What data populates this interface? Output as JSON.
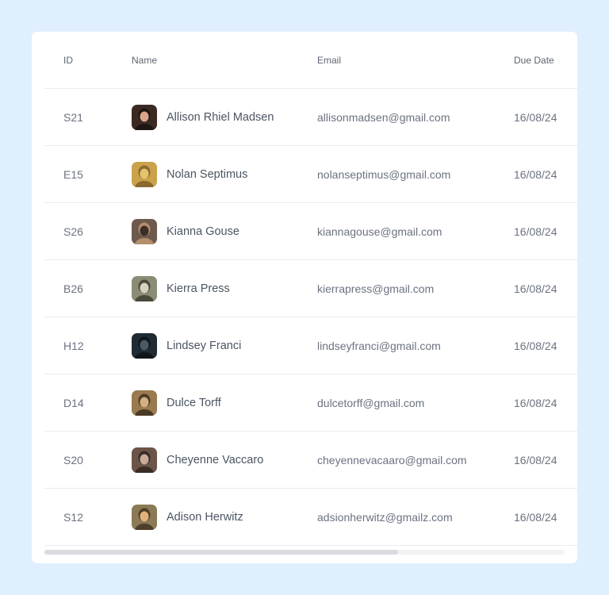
{
  "table": {
    "headers": {
      "id": "ID",
      "name": "Name",
      "email": "Email",
      "due_date": "Due Date"
    },
    "rows": [
      {
        "id": "S21",
        "name": "Allison Rhiel Madsen",
        "email": "allisonmadsen@gmail.com",
        "due_date": "16/08/24",
        "avatar_colors": [
          "#3b2a22",
          "#d9a48a",
          "#1d1612"
        ]
      },
      {
        "id": "E15",
        "name": "Nolan Septimus",
        "email": "nolanseptimus@gmail.com",
        "due_date": "16/08/24",
        "avatar_colors": [
          "#c9a24b",
          "#e6c46c",
          "#8b6a2f"
        ]
      },
      {
        "id": "S26",
        "name": "Kianna Gouse",
        "email": "kiannagouse@gmail.com",
        "due_date": "16/08/24",
        "avatar_colors": [
          "#6e5a4c",
          "#3a2e28",
          "#b48f6d"
        ]
      },
      {
        "id": "B26",
        "name": "Kierra Press",
        "email": "kierrapress@gmail.com",
        "due_date": "16/08/24",
        "avatar_colors": [
          "#8a8c76",
          "#d7d2c0",
          "#4b4a3a"
        ]
      },
      {
        "id": "H12",
        "name": "Lindsey Franci",
        "email": "lindseyfranci@gmail.com",
        "due_date": "16/08/24",
        "avatar_colors": [
          "#1f2a33",
          "#4a5967",
          "#0f151a"
        ]
      },
      {
        "id": "D14",
        "name": "Dulce Torff",
        "email": "dulcetorff@gmail.com",
        "due_date": "16/08/24",
        "avatar_colors": [
          "#9a7a4e",
          "#d2b083",
          "#4b3a25"
        ]
      },
      {
        "id": "S20",
        "name": "Cheyenne Vaccaro",
        "email": "cheyennevacaaro@gmail.com",
        "due_date": "16/08/24",
        "avatar_colors": [
          "#6c5547",
          "#c9ab98",
          "#3a2d26"
        ]
      },
      {
        "id": "S12",
        "name": "Adison Herwitz",
        "email": "adsionherwitz@gmailz.com",
        "due_date": "16/08/24",
        "avatar_colors": [
          "#8b7a55",
          "#e0b27a",
          "#4e3f2a"
        ]
      }
    ]
  },
  "scroll": {
    "position_fraction": 0
  }
}
